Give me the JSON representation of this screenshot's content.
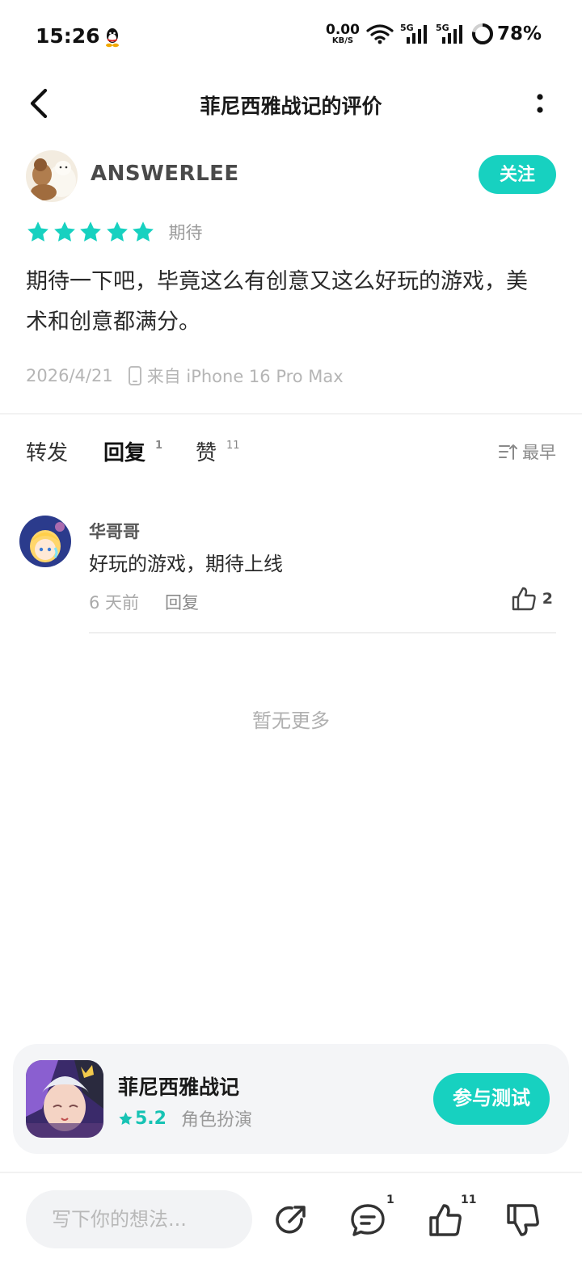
{
  "status_bar": {
    "time": "15:26",
    "net_speed_value": "0.00",
    "net_speed_unit": "KB/S",
    "signal_1": "5G",
    "signal_2": "5G",
    "battery": "78%"
  },
  "header": {
    "title": "菲尼西雅战记的评价"
  },
  "review": {
    "author": "ANSWERLEE",
    "follow_label": "关注",
    "stars": 5,
    "rating_label": "期待",
    "text": "期待一下吧，毕竟这么有创意又这么好玩的游戏，美术和创意都满分。",
    "date": "2026/4/21",
    "device": "来自 iPhone 16 Pro Max"
  },
  "tabs": {
    "repost": {
      "label": "转发"
    },
    "reply": {
      "label": "回复",
      "count": "1"
    },
    "like": {
      "label": "赞",
      "count": "11"
    },
    "sort": "最早"
  },
  "comments": [
    {
      "name": "华哥哥",
      "text": "好玩的游戏，期待上线",
      "time": "6 天前",
      "reply_label": "回复",
      "likes": "2"
    }
  ],
  "no_more": "暂无更多",
  "game_card": {
    "name": "菲尼西雅战记",
    "score": "5.2",
    "genre": "角色扮演",
    "button": "参与测试"
  },
  "bottom_bar": {
    "placeholder": "写下你的想法...",
    "comment_count": "1",
    "like_count": "11"
  },
  "colors": {
    "accent": "#17d1c0"
  }
}
